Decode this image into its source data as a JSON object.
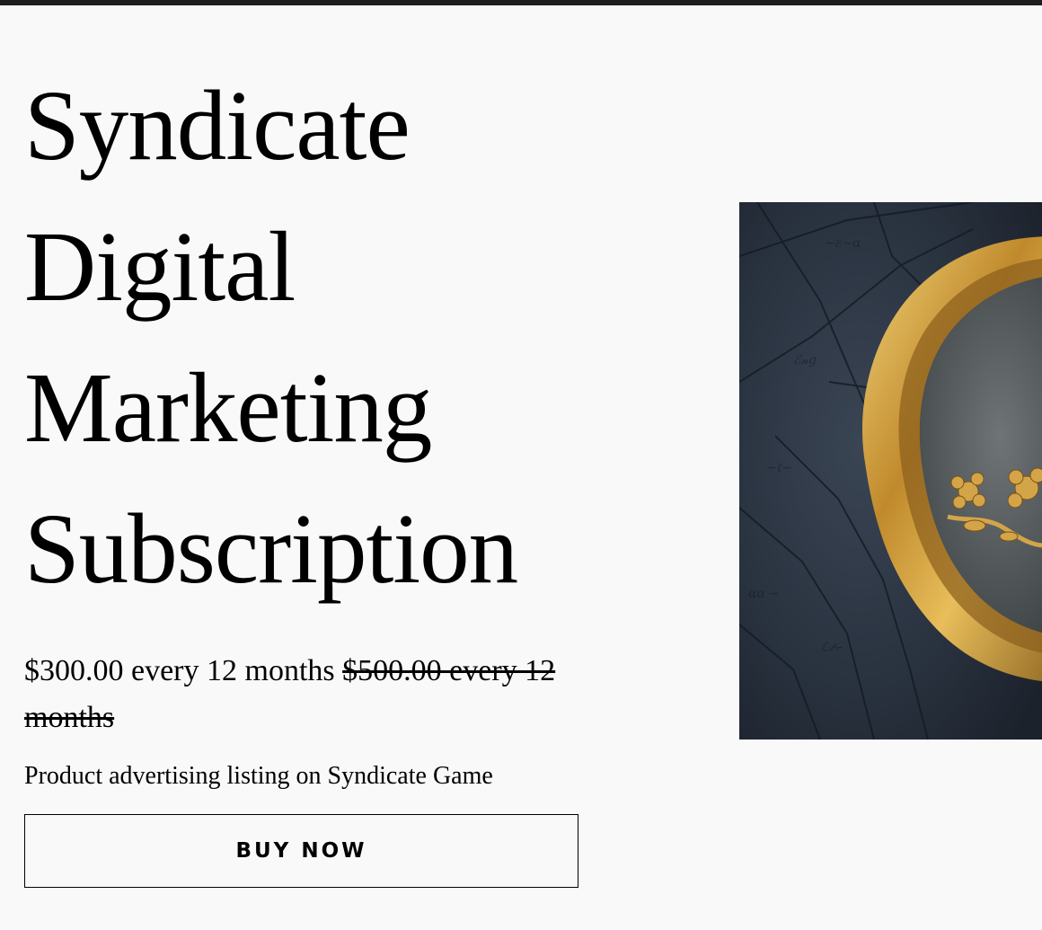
{
  "product": {
    "title_lines": [
      "Syndicate",
      "Digital",
      "Marketing",
      "Subscription"
    ],
    "price": "$300.00 every 12 months",
    "compare_price": "$500.00 every 12 months",
    "description": "Product advertising listing on Syndicate Game",
    "buy_label": "BUY NOW",
    "image_icon": "gold-wax-seal-image"
  },
  "colors": {
    "background": "#f9f9f9",
    "top_bar": "#1e1e1e",
    "text": "#000000",
    "seal_gold": "#b8862e",
    "map_dark": "#27303c"
  }
}
